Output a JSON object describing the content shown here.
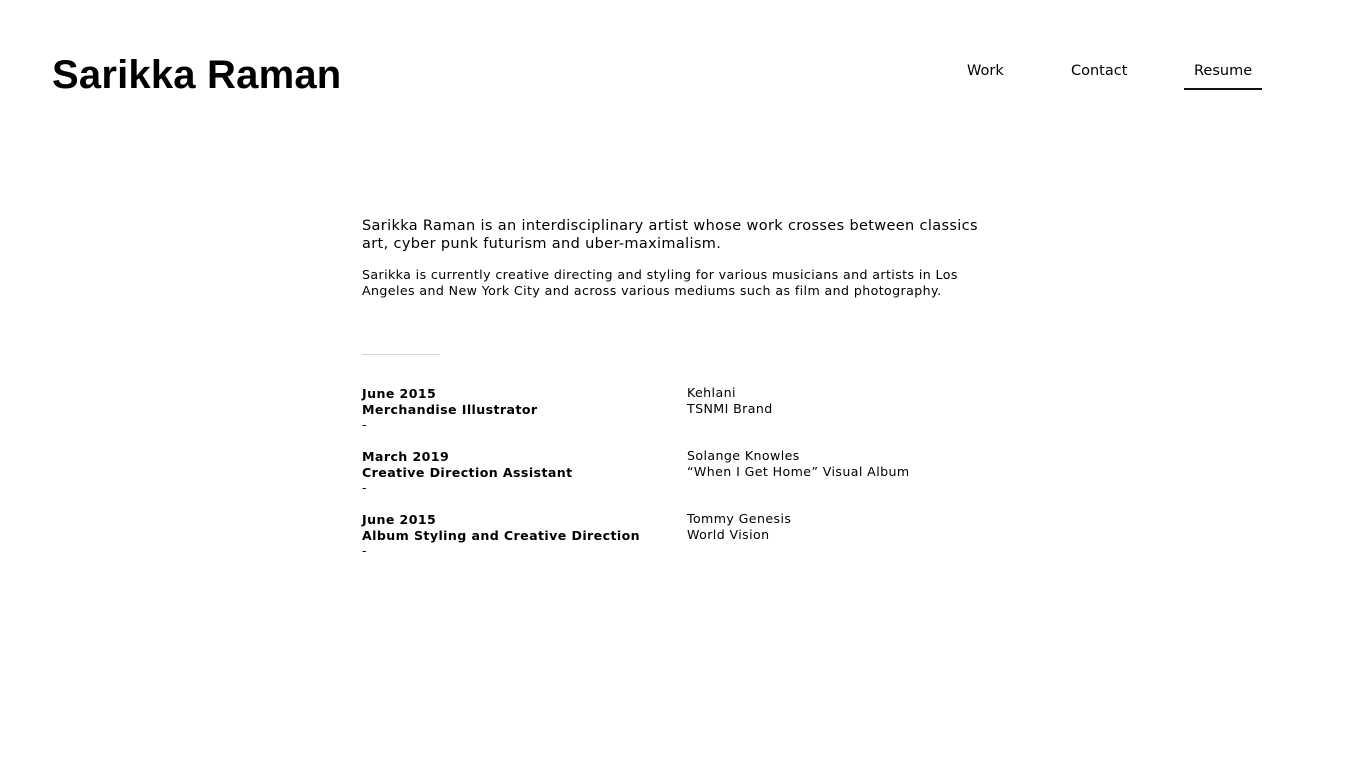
{
  "header": {
    "site_title": "Sarikka Raman"
  },
  "nav": {
    "items": [
      {
        "label": "Work"
      },
      {
        "label": "Contact"
      },
      {
        "label": "Resume"
      }
    ],
    "active": "Resume"
  },
  "bio": {
    "lead": "Sarikka Raman is an interdisciplinary artist whose work crosses between classics art, cyber punk futurism and uber-maximalism.",
    "secondary": "Sarikka is currently creative directing and styling for various musicians and artists in Los Angeles and New York City and across various mediums such as film and photography."
  },
  "resume": {
    "entries": [
      {
        "date": "June 2015",
        "role": "Merchandise Illustrator",
        "dash": "-",
        "client": "Kehlani",
        "project": "TSNMI Brand"
      },
      {
        "date": "March 2019",
        "role": "Creative Direction Assistant",
        "dash": "-",
        "client": "Solange Knowles",
        "project": "“When I Get Home” Visual Album"
      },
      {
        "date": "June 2015",
        "role": "Album Styling and Creative Direction",
        "dash": "-",
        "client": "Tommy Genesis",
        "project": "World Vision"
      }
    ]
  },
  "colors": {
    "text": "#000000",
    "background": "#ffffff",
    "divider": "#d6d6d6"
  }
}
